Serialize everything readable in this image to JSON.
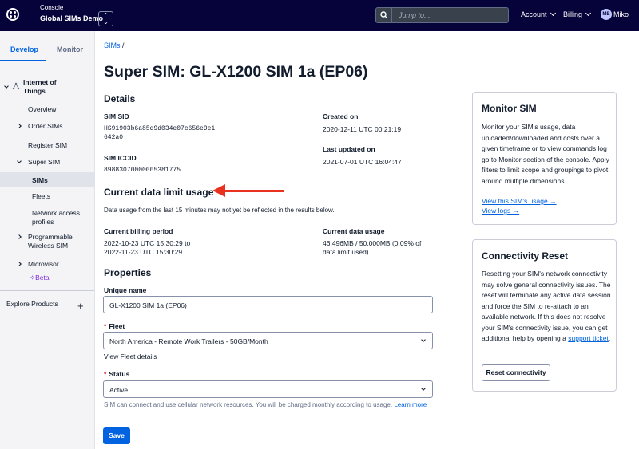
{
  "topbar": {
    "console_label": "Console",
    "account_name": "Global SIMs Demo",
    "search_placeholder": "Jump to...",
    "nav": [
      "Account",
      "Billing"
    ],
    "user_initials": "MB",
    "user_name": "Miko"
  },
  "sidebar": {
    "tabs": [
      "Develop",
      "Monitor"
    ],
    "iot_label": "Internet of Things",
    "items": {
      "overview": "Overview",
      "order_sims": "Order SIMs",
      "register_sim": "Register SIM",
      "super_sim": "Super SIM",
      "sims": "SIMs",
      "fleets": "Fleets",
      "network_access": "Network access profiles",
      "programmable": "Programmable Wireless SIM",
      "microvisor": "Microvisor",
      "beta": "Beta"
    },
    "explore": "Explore Products"
  },
  "main": {
    "breadcrumb": "SIMs",
    "breadcrumb_sep": "/",
    "title": "Super SIM: GL-X1200 SIM 1a (EP06)",
    "details": {
      "heading": "Details",
      "sid_label": "SIM SID",
      "sid_value_1": "HS91903b6a85d9d034e07c656e9e1",
      "sid_value_2": "642a0",
      "iccid_label": "SIM ICCID",
      "iccid_value": "89883070000005381775",
      "created_label": "Created on",
      "created_value": "2020-12-11 UTC 00:21:19",
      "updated_label": "Last updated on",
      "updated_value": "2021-07-01 UTC 16:04:47"
    },
    "usage": {
      "heading": "Current data limit usage",
      "note": "Data usage from the last 15 minutes may not yet be reflected in the results below.",
      "period_label": "Current billing period",
      "period_1": "2022-10-23 UTC 15:30:29 to",
      "period_2": "2022-11-23 UTC 15:30:29",
      "data_label": "Current data usage",
      "data_1": "46.496MB / 50,000MB (0.09% of",
      "data_2": "data limit used)"
    },
    "properties": {
      "heading": "Properties",
      "name_label": "Unique name",
      "name_value": "GL-X1200 SIM 1a (EP06)",
      "fleet_label": "Fleet",
      "fleet_value": "North America - Remote Work Trailers - 50GB/Month",
      "fleet_link": "View Fleet details",
      "status_label": "Status",
      "status_value": "Active",
      "status_help": "SIM can connect and use cellular network resources. You will be charged monthly according to usage.",
      "learn_more": "Learn more",
      "save": "Save"
    }
  },
  "monitor_card": {
    "title": "Monitor SIM",
    "body": "Monitor your SIM's usage, data uploaded/downloaded and costs over a given timeframe or to view commands log go to Monitor section of the console. Apply filters to limit scope and groupings to pivot around multiple dimensions.",
    "link_usage": "View this SIM's usage →",
    "link_logs": "View logs →"
  },
  "reset_card": {
    "title": "Connectivity Reset",
    "body": "Resetting your SIM's network connectivity may solve general connectivity issues. The reset will terminate any active data session and force the SIM to re-attach to an available network. If this does not resolve your SIM's connectivity issue, you can get additional help by opening a",
    "support_link": "support ticket",
    "support_suffix": ".",
    "button": "Reset connectivity"
  },
  "colors": {
    "topbar": "#06033a",
    "accent": "#0263e0",
    "annotation_arrow": "#e8321f"
  }
}
